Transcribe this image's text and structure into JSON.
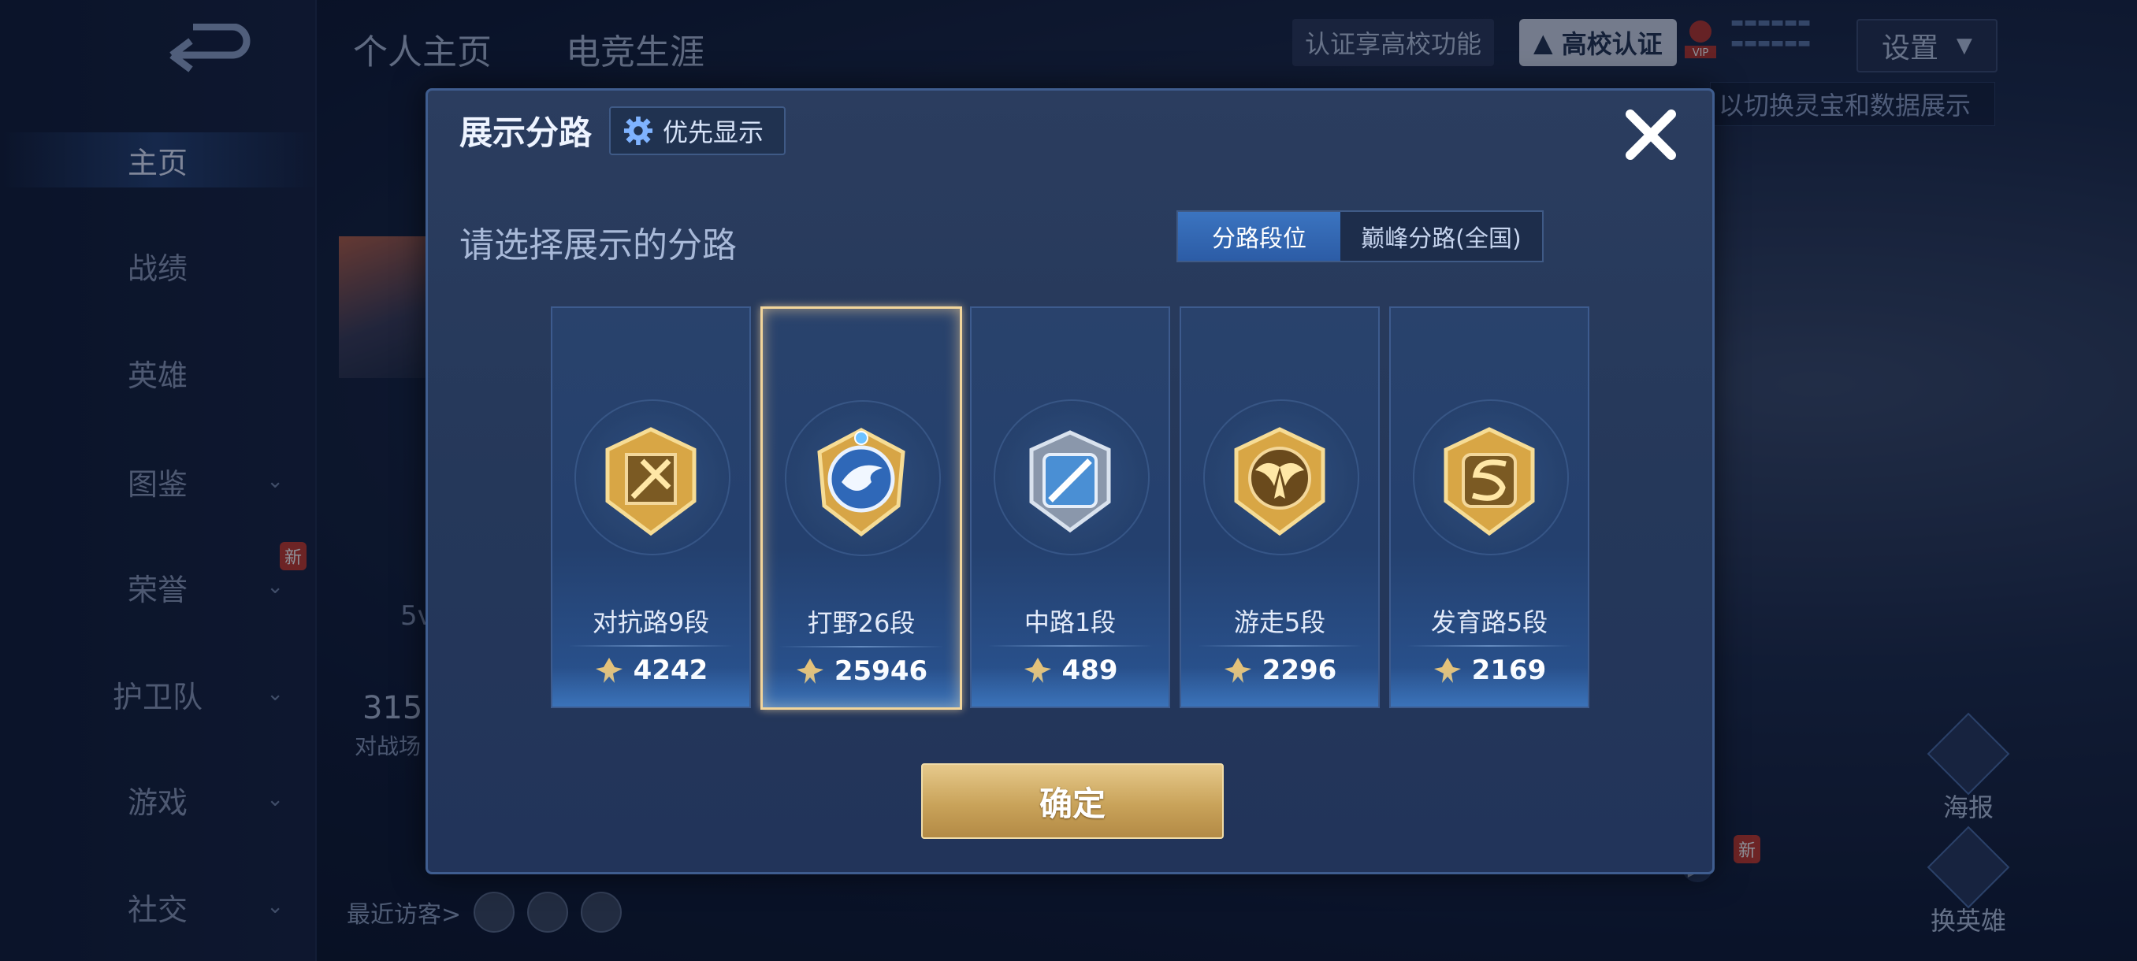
{
  "nav": {
    "items": [
      {
        "label": "主页",
        "active": true
      },
      {
        "label": "战绩"
      },
      {
        "label": "英雄"
      },
      {
        "label": "图鉴"
      },
      {
        "label": "荣誉"
      },
      {
        "label": "护卫队"
      },
      {
        "label": "游戏"
      },
      {
        "label": "社交"
      }
    ],
    "new_badge": "新"
  },
  "top": {
    "tab_profile": "个人主页",
    "tab_career": "电竞生涯",
    "cert_text": "认证享高校功能",
    "uni_cert": "高校认证",
    "vip_label": "VIP",
    "settings": "设置",
    "hint": "以切换灵宝和数据展示"
  },
  "bg": {
    "fragment_5v": "5v",
    "fragment_315": "315",
    "fragment_battle": "对战场",
    "visitors_label": "最近访客>",
    "poster_label": "海报",
    "swap_hero_label": "换英雄",
    "new_badge": "新"
  },
  "dialog": {
    "title": "展示分路",
    "priority_label": "优先显示",
    "subtitle": "请选择展示的分路",
    "seg_left": "分路段位",
    "seg_right": "巅峰分路(全国)",
    "confirm": "确定",
    "cards": [
      {
        "lane": "对抗路9段",
        "score": "4242",
        "emblem": "sword-emblem-icon",
        "selected": false
      },
      {
        "lane": "打野26段",
        "score": "25946",
        "emblem": "dragon-emblem-icon",
        "selected": true
      },
      {
        "lane": "中路1段",
        "score": "489",
        "emblem": "slash-emblem-icon",
        "selected": false
      },
      {
        "lane": "游走5段",
        "score": "2296",
        "emblem": "wings-emblem-icon",
        "selected": false
      },
      {
        "lane": "发育路5段",
        "score": "2169",
        "emblem": "arrows-emblem-icon",
        "selected": false
      }
    ]
  },
  "colors": {
    "accent_blue": "#3b74c0",
    "gold": "#c9a35a",
    "selected_border": "#f2d59b"
  }
}
